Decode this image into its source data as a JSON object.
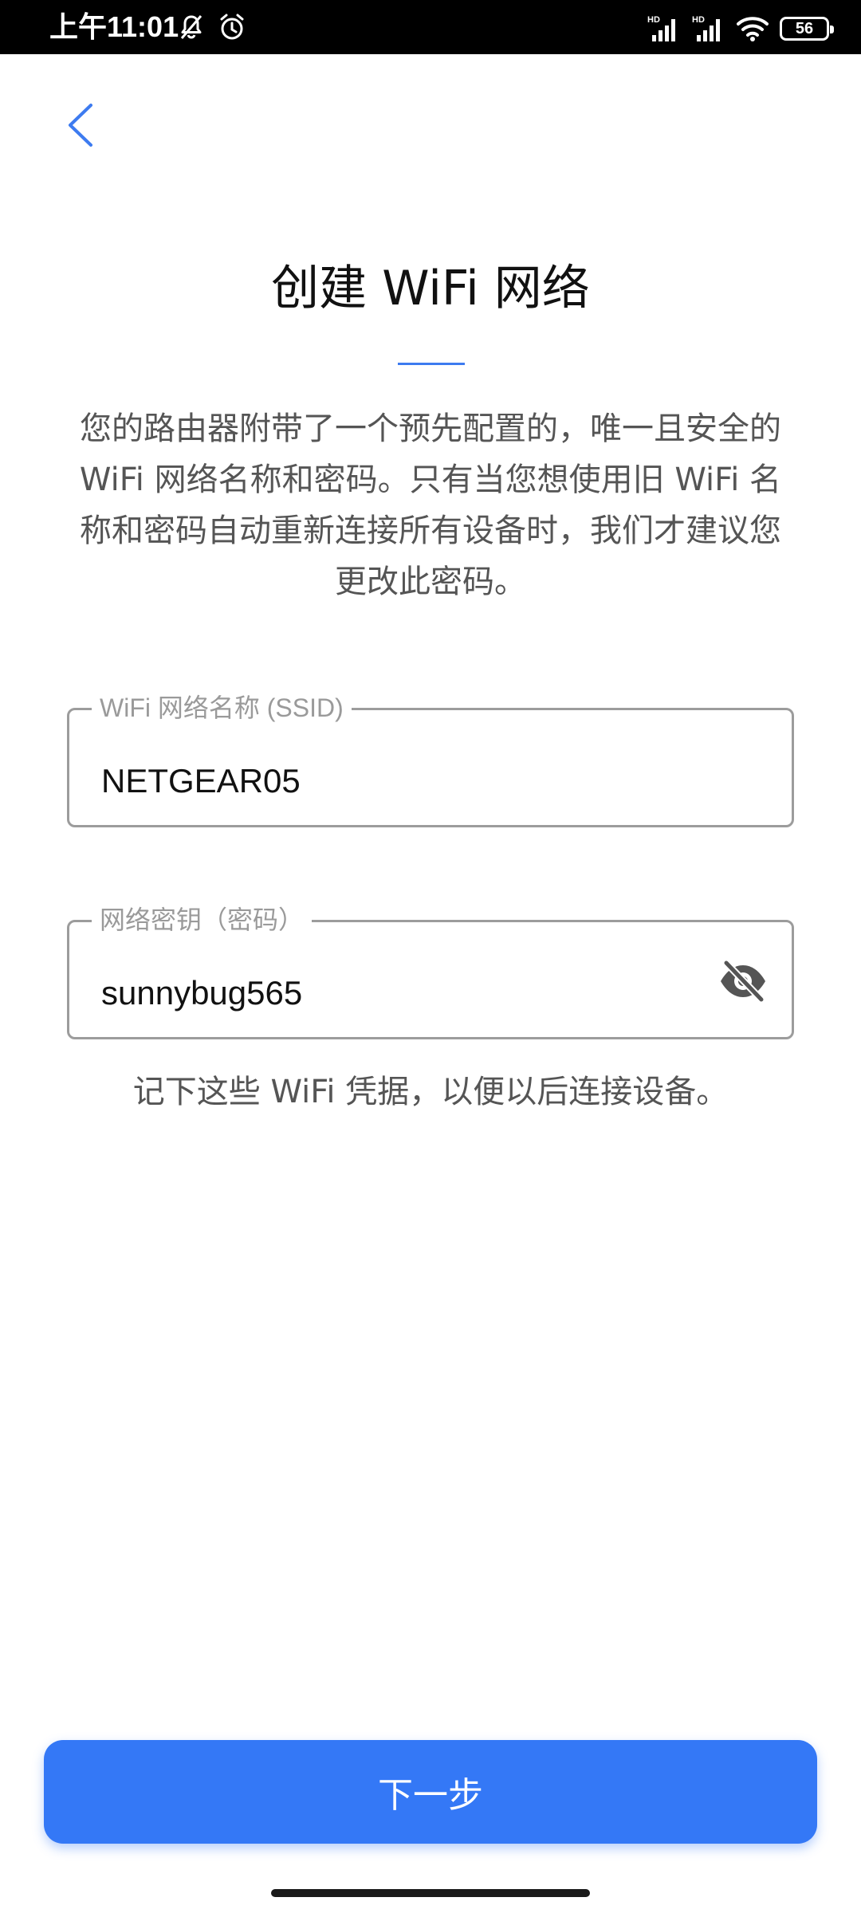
{
  "status_bar": {
    "time": "上午11:01",
    "battery_level": "56",
    "icons": [
      "mute-bell-icon",
      "alarm-icon",
      "hd-signal-icon",
      "hd-signal-icon",
      "wifi-icon",
      "battery-icon"
    ],
    "network_badge": "HD"
  },
  "header": {
    "back_icon": "chevron-left-icon",
    "title": "创建 WiFi 网络"
  },
  "description": "您的路由器附带了一个预先配置的，唯一且安全的 WiFi 网络名称和密码。只有当您想使用旧 WiFi 名称和密码自动重新连接所有设备时，我们才建议您更改此密码。",
  "form": {
    "ssid": {
      "label": "WiFi 网络名称 (SSID)",
      "value": "NETGEAR05"
    },
    "password": {
      "label": "网络密钥（密码）",
      "value": "sunnybug565",
      "toggle_icon": "eye-off-icon"
    }
  },
  "hint": "记下这些 WiFi 凭据，以便以后连接设备。",
  "footer": {
    "next_label": "下一步"
  },
  "colors": {
    "accent": "#3478f6",
    "back_arrow": "#3d7bf0",
    "field_border": "#9c9c9c"
  }
}
